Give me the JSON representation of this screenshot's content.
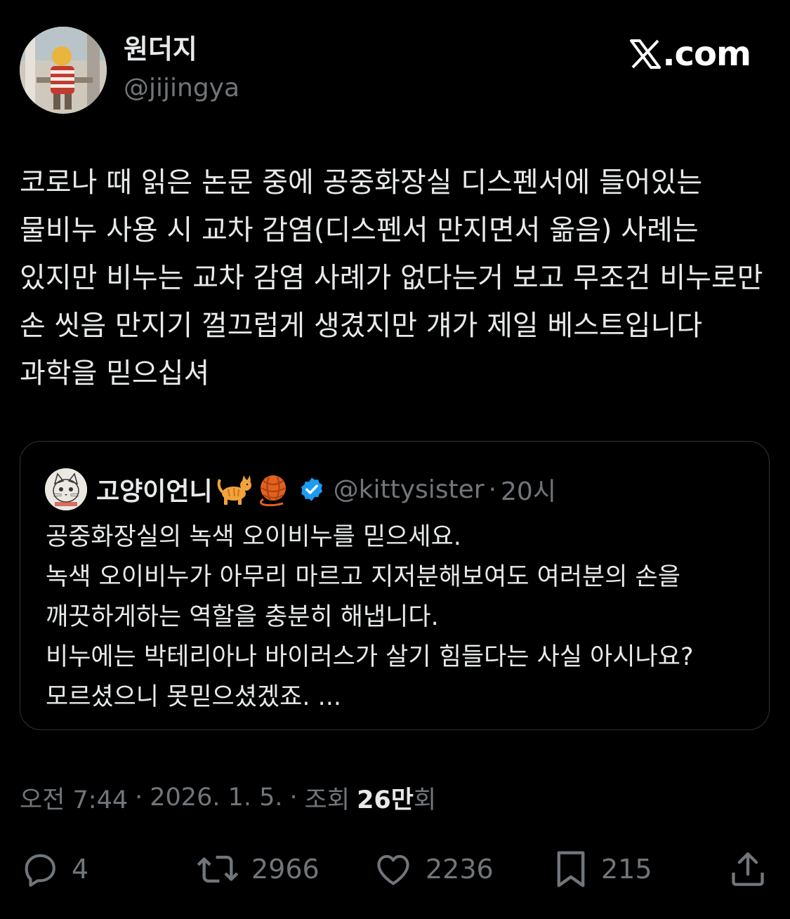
{
  "header": {
    "author_name": "원더지",
    "author_handle": "@jijingya",
    "brand_label": ".com"
  },
  "tweet": {
    "text": "코로나 때 읽은 논문 중에 공중화장실 디스펜서에 들어있는 물비누 사용 시 교차 감염(디스펜서 만지면서 옮음) 사례는 있지만 비누는 교차 감염 사례가 없다는거 보고 무조건 비누로만 손 씻음 만지기 껄끄럽게 생겼지만 걔가 제일 베스트입니다 과학을 믿으십셔"
  },
  "quote": {
    "name": "고양이언니",
    "handle": "@kittysister",
    "separator": "·",
    "time": "20시",
    "text": "공중화장실의 녹색 오이비누를 믿으세요.\n녹색 오이비누가 아무리 마르고 지저분해보여도 여러분의 손을 깨끗하게하는 역할을 충분히 해냅니다.\n비누에는 박테리아나 바이러스가 살기 힘들다는 사실 아시나요?모르셨으니 못믿으셨겠죠. ..."
  },
  "meta": {
    "time": "오전 7:44",
    "separator": "·",
    "date": "2026. 1. 5.",
    "views_prefix": "조회",
    "views_count": "26만",
    "views_suffix": "회"
  },
  "actions": {
    "reply_count": "4",
    "retweet_count": "2966",
    "like_count": "2236",
    "bookmark_count": "215"
  },
  "colors": {
    "background": "#000000",
    "text_primary": "#e7e9ea",
    "text_secondary": "#71767b",
    "border": "#2f3336",
    "verified_blue": "#1d9bf0"
  },
  "icons": [
    "x-logo-icon",
    "verified-badge-icon",
    "cat-emoji-icon",
    "yarn-emoji-icon",
    "reply-icon",
    "retweet-icon",
    "like-icon",
    "bookmark-icon",
    "share-icon"
  ]
}
